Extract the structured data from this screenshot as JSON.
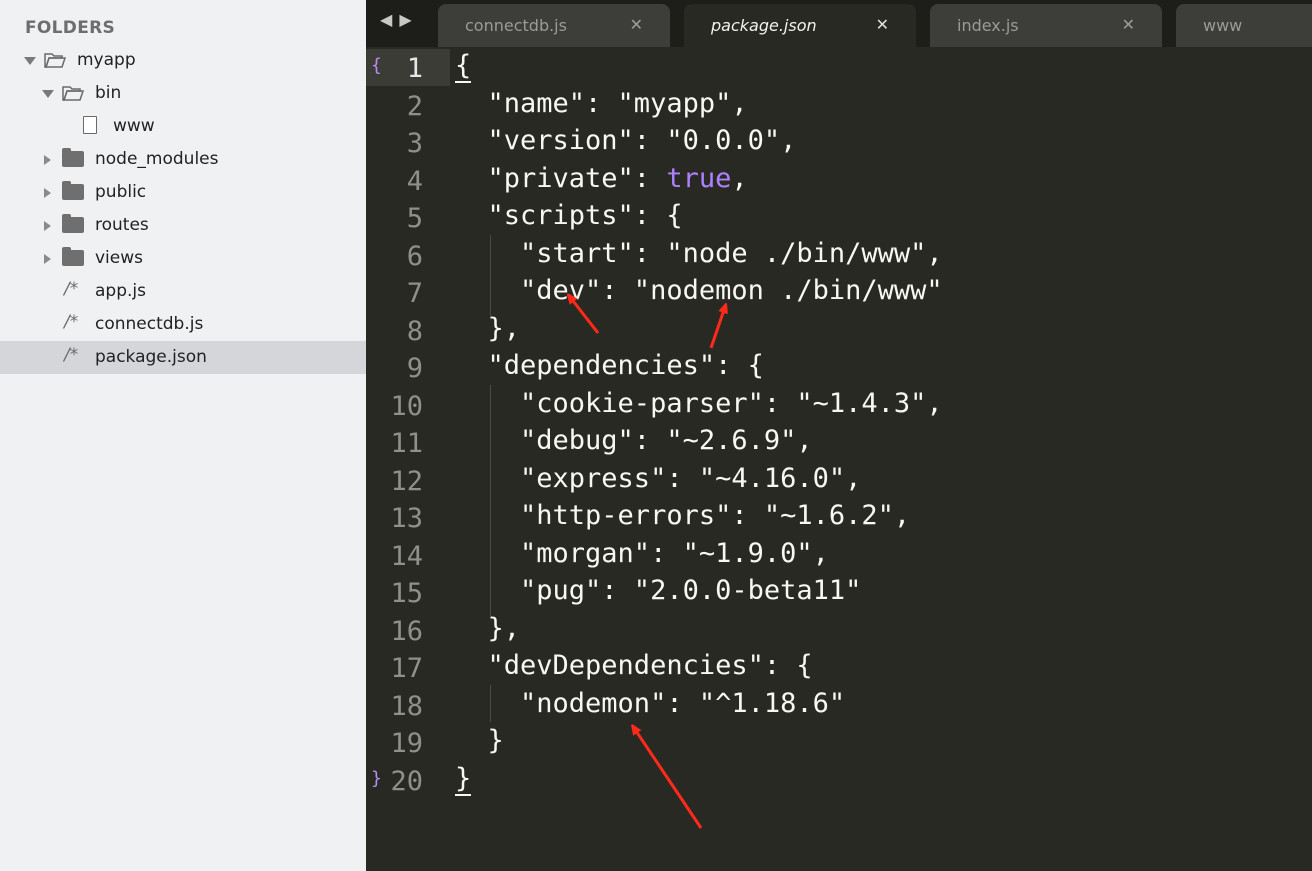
{
  "sidebar": {
    "header": "FOLDERS",
    "items": [
      {
        "label": "myapp",
        "type": "folder-open",
        "depth": 0
      },
      {
        "label": "bin",
        "type": "folder-open",
        "depth": 1
      },
      {
        "label": "www",
        "type": "file",
        "depth": 2
      },
      {
        "label": "node_modules",
        "type": "folder",
        "depth": 1
      },
      {
        "label": "public",
        "type": "folder",
        "depth": 1
      },
      {
        "label": "routes",
        "type": "folder",
        "depth": 1
      },
      {
        "label": "views",
        "type": "folder",
        "depth": 1
      },
      {
        "label": "app.js",
        "type": "js",
        "depth": 1
      },
      {
        "label": "connectdb.js",
        "type": "js",
        "depth": 1
      },
      {
        "label": "package.json",
        "type": "js",
        "depth": 1,
        "selected": true
      }
    ]
  },
  "tabs": [
    {
      "label": "connectdb.js",
      "close": "✕"
    },
    {
      "label": "package.json",
      "close": "✕",
      "active": true
    },
    {
      "label": "index.js",
      "close": "✕"
    },
    {
      "label": "www"
    }
  ],
  "nav": {
    "back": "◀",
    "forward": "▶"
  },
  "editor": {
    "current_line": 1,
    "lines": [
      {
        "n": "1",
        "text": "{"
      },
      {
        "n": "2",
        "text": "  \"name\": \"myapp\","
      },
      {
        "n": "3",
        "text": "  \"version\": \"0.0.0\","
      },
      {
        "n": "4",
        "text": "  \"private\": ",
        "kw": "true",
        "after": ","
      },
      {
        "n": "5",
        "text": "  \"scripts\": {"
      },
      {
        "n": "6",
        "text": "    \"start\": \"node ./bin/www\","
      },
      {
        "n": "7",
        "text": "    \"dev\": \"nodemon ./bin/www\""
      },
      {
        "n": "8",
        "text": "  },"
      },
      {
        "n": "9",
        "text": "  \"dependencies\": {"
      },
      {
        "n": "10",
        "text": "    \"cookie-parser\": \"~1.4.3\","
      },
      {
        "n": "11",
        "text": "    \"debug\": \"~2.6.9\","
      },
      {
        "n": "12",
        "text": "    \"express\": \"~4.16.0\","
      },
      {
        "n": "13",
        "text": "    \"http-errors\": \"~1.6.2\","
      },
      {
        "n": "14",
        "text": "    \"morgan\": \"~1.9.0\","
      },
      {
        "n": "15",
        "text": "    \"pug\": \"2.0.0-beta11\""
      },
      {
        "n": "16",
        "text": "  },"
      },
      {
        "n": "17",
        "text": "  \"devDependencies\": {"
      },
      {
        "n": "18",
        "text": "    \"nodemon\": \"^1.18.6\""
      },
      {
        "n": "19",
        "text": "  }"
      },
      {
        "n": "20",
        "text": "}"
      }
    ],
    "fold_open": "{",
    "fold_close": "}"
  },
  "colors": {
    "accent_annotation": "#ff2a1a",
    "keyword": "#ae81ff"
  }
}
